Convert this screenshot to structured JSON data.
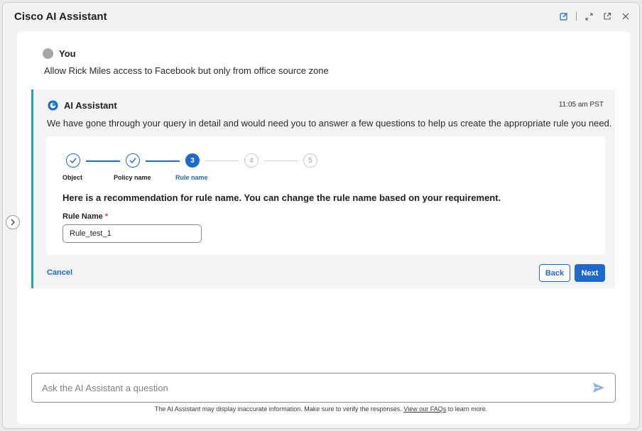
{
  "app": {
    "title": "Cisco AI Assistant"
  },
  "header_icons": [
    "edit-icon",
    "expand-icon",
    "pop-out-icon",
    "close-icon"
  ],
  "user_message": {
    "sender": "You",
    "text": "Allow Rick Miles access to Facebook but only from office source zone"
  },
  "ai_message": {
    "sender": "AI Assistant",
    "time": "11:05 am PST",
    "text": "We have gone through your query in detail and would need you to answer a few questions to help us create the appropriate rule you need."
  },
  "wizard": {
    "current_step": 3,
    "steps": [
      {
        "number": "1",
        "label": "Object",
        "state": "done"
      },
      {
        "number": "2",
        "label": "Policy name",
        "state": "done"
      },
      {
        "number": "3",
        "label": "Rule name",
        "state": "active"
      },
      {
        "number": "4",
        "label": "",
        "state": "todo"
      },
      {
        "number": "5",
        "label": "",
        "state": "todo"
      }
    ],
    "recommendation": "Here is a recommendation for rule name. You can change the rule name based on your requirement.",
    "field_label": "Rule Name",
    "required_mark": "*",
    "field_value": "Rule_test_1"
  },
  "actions": {
    "cancel": "Cancel",
    "back": "Back",
    "next": "Next"
  },
  "chat": {
    "placeholder": "Ask the AI Assistant a question"
  },
  "footer": {
    "disclaimer": "The AI Assistant may display inaccurate information. Make sure to verify the responses.",
    "faq_link": "View our FAQs",
    "suffix": "to learn more."
  },
  "colors": {
    "accent": "#1d69cc",
    "card_border": "#1ba0d7",
    "required": "#d13a3a"
  }
}
